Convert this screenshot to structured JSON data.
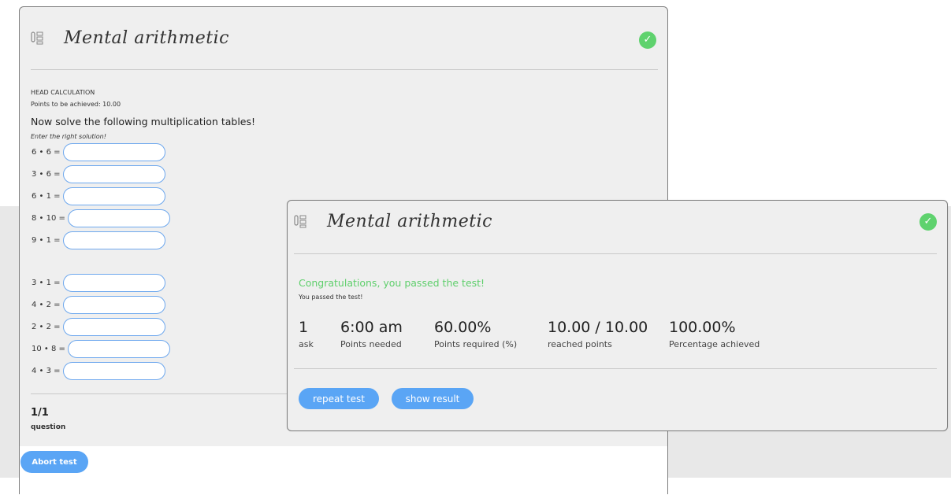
{
  "quiz": {
    "title": "Mental arithmetic",
    "section": "HEAD CALCULATION",
    "points_note": "Points to be achieved: 10.00",
    "instruction": "Now solve the following multiplication tables!",
    "hint": "Enter the right solution!",
    "problems": [
      {
        "label": "6 • 6 =",
        "value": ""
      },
      {
        "label": "3 • 6 =",
        "value": ""
      },
      {
        "label": "6 • 1 =",
        "value": ""
      },
      {
        "label": "8 • 10 =",
        "value": ""
      },
      {
        "label": "9 • 1 =",
        "value": ""
      },
      {
        "label": "3 • 1 =",
        "value": ""
      },
      {
        "label": "4 • 2 =",
        "value": ""
      },
      {
        "label": "2 • 2 =",
        "value": ""
      },
      {
        "label": "10 • 8 =",
        "value": ""
      },
      {
        "label": "4 • 3 =",
        "value": ""
      }
    ],
    "counter": "1/1",
    "counter_label": "question",
    "abort_label": "Abort test"
  },
  "result": {
    "title": "Mental arithmetic",
    "congrats": "Congratulations, you passed the test!",
    "subtitle": "You passed the test!",
    "stats": [
      {
        "value": "1",
        "caption": "ask"
      },
      {
        "value": "6:00 am",
        "caption": "Points needed"
      },
      {
        "value": "60.00%",
        "caption": "Points required (%)"
      },
      {
        "value": "10.00 / 10.00",
        "caption": "reached points"
      },
      {
        "value": "100.00%",
        "caption": "Percentage achieved"
      }
    ],
    "repeat_label": "repeat test",
    "show_label": "show result"
  },
  "colors": {
    "accent_blue": "#5aa5f5",
    "success_green": "#5fd26e",
    "input_border": "#6ea8ee"
  },
  "icons": {
    "title_icon": "checklist-icon",
    "status_icon": "check-circle-icon"
  }
}
